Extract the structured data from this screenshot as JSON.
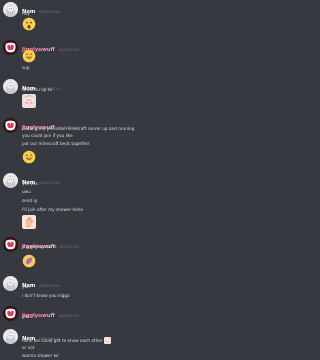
{
  "users": {
    "nom": "Nom",
    "jiggly": "Jigglyuwuff"
  },
  "timestamps": {
    "t1": "00/00/2020",
    "t2": "00/00/2020",
    "t3": "00/00/2020",
    "t4": "00/00/2020",
    "t5": "00/00/2020",
    "t6": "00/00/2020",
    "t7": "00/00/2020",
    "t8": "00/00/2020",
    "t9": "00/00/2020"
  },
  "messages": {
    "m1": [
      "hey"
    ],
    "m2": [
      "sup"
    ],
    "m3": [
      "whatchu up to"
    ],
    "m4": [
      "Getting my personal minecraft server up and running",
      "you could join if you like",
      "put our minecraft beds together"
    ],
    "m5": [
      "yes yes",
      "uwu",
      "send ip",
      "I'll join after my shower hehe"
    ],
    "m6": [
      "showering alone"
    ],
    "m7": [
      "yuh",
      "i don't know you nigga"
    ],
    "m8": [
      "yes"
    ],
    "m9": [
      "hehe we could get to know each other",
      "or not",
      "wanna shower w/"
    ]
  },
  "emojis": {
    "e1": "surprised-face-emoji",
    "e2": "smiling-face-emoji",
    "e3": "blush-face-emoji",
    "e4": "smiling-face-emoji",
    "e5": "wave-hand-emoji",
    "e6": "eggplant-emoji",
    "e7": "blush-face-emoji"
  },
  "colors": {
    "background": "#36393f",
    "nom_name": "#ffffff",
    "jiggly_name": "#ff8fb0",
    "timestamp": "#72767d",
    "text": "#dcddde",
    "emoji_yellow": "#ffcc4d"
  }
}
